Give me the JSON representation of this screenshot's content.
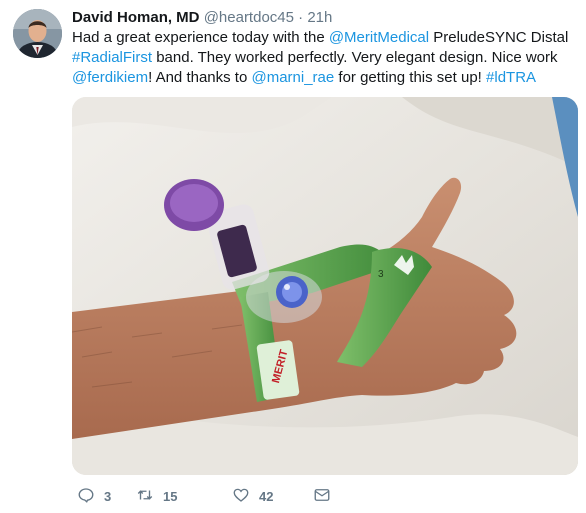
{
  "author": {
    "display_name": "David Homan, MD",
    "handle": "@heartdoc45",
    "separator": "·",
    "time": "21h"
  },
  "tweet": {
    "segments": [
      {
        "text": "Had a great experience today with the ",
        "link": false
      },
      {
        "text": "@MeritMedical",
        "link": true
      },
      {
        "text": " PreludeSYNC Distal ",
        "link": false
      },
      {
        "text": "#RadialFirst",
        "link": true
      },
      {
        "text": " band. They worked perfectly. Very elegant design. Nice work ",
        "link": false
      },
      {
        "text": "@ferdikiem",
        "link": true
      },
      {
        "text": "! And thanks to ",
        "link": false
      },
      {
        "text": "@marni_rae",
        "link": true
      },
      {
        "text": " for getting this set up! ",
        "link": false
      },
      {
        "text": "#ldTRA",
        "link": true
      }
    ]
  },
  "media": {
    "band_brand": "MERIT",
    "band_number": "3"
  },
  "actions": {
    "replies": "3",
    "retweets": "15",
    "likes": "42"
  },
  "colors": {
    "link": "#1b95e0",
    "muted": "#657786",
    "text": "#14171a"
  },
  "icons": [
    "reply-icon",
    "retweet-icon",
    "like-icon",
    "direct-message-icon"
  ]
}
